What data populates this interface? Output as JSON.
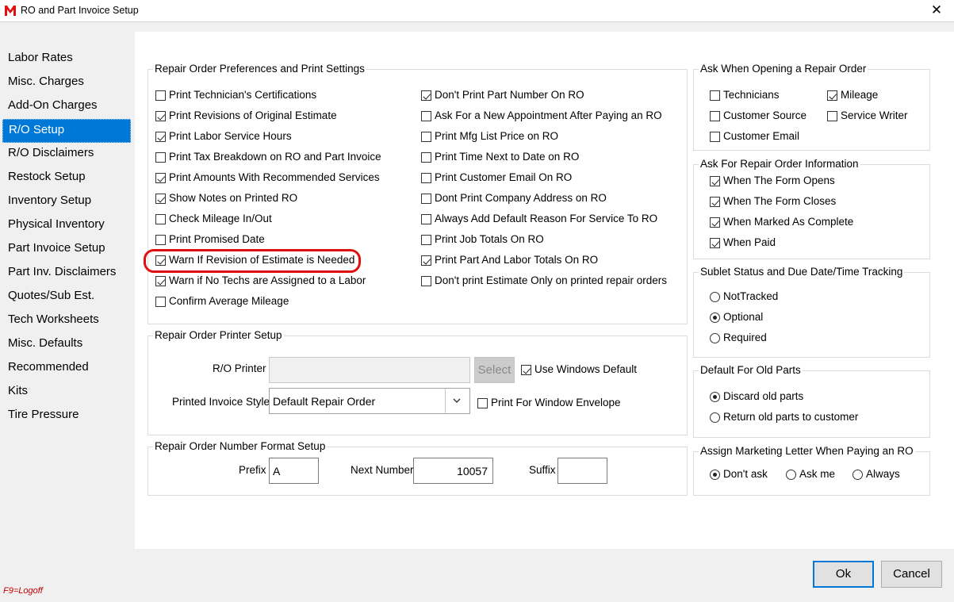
{
  "window": {
    "title": "RO and Part Invoice Setup",
    "close_glyph": "✕",
    "logo_icon": "m-logo-icon",
    "logo_color": "#e01010"
  },
  "sidebar": {
    "items": [
      {
        "label": "Labor Rates",
        "selected": false
      },
      {
        "label": "Misc. Charges",
        "selected": false
      },
      {
        "label": "Add-On Charges",
        "selected": false
      },
      {
        "label": "R/O Setup",
        "selected": true
      },
      {
        "label": "R/O Disclaimers",
        "selected": false
      },
      {
        "label": "Restock Setup",
        "selected": false
      },
      {
        "label": "Inventory Setup",
        "selected": false
      },
      {
        "label": "Physical Inventory",
        "selected": false
      },
      {
        "label": "Part Invoice Setup",
        "selected": false
      },
      {
        "label": "Part Inv. Disclaimers",
        "selected": false
      },
      {
        "label": "Quotes/Sub Est.",
        "selected": false
      },
      {
        "label": "Tech Worksheets",
        "selected": false
      },
      {
        "label": "Misc. Defaults",
        "selected": false
      },
      {
        "label": "Recommended",
        "selected": false
      },
      {
        "label": "Kits",
        "selected": false
      },
      {
        "label": "Tire Pressure",
        "selected": false
      }
    ]
  },
  "prefs": {
    "title": "Repair Order Preferences and Print Settings",
    "left": [
      {
        "label": "Print Technician's Certifications",
        "checked": false
      },
      {
        "label": "Print Revisions of Original Estimate",
        "checked": true
      },
      {
        "label": "Print Labor Service Hours",
        "checked": true
      },
      {
        "label": "Print Tax Breakdown on RO and Part Invoice",
        "checked": false
      },
      {
        "label": "Print Amounts With Recommended Services",
        "checked": true
      },
      {
        "label": "Show Notes on Printed RO",
        "checked": true
      },
      {
        "label": "Check Mileage In/Out",
        "checked": false
      },
      {
        "label": "Print Promised Date",
        "checked": false
      },
      {
        "label": "Warn If Revision of Estimate is Needed",
        "checked": true
      },
      {
        "label": "Warn if No Techs are Assigned to a Labor",
        "checked": true
      },
      {
        "label": "Confirm Average Mileage",
        "checked": false
      }
    ],
    "right": [
      {
        "label": "Don't Print Part Number On RO",
        "checked": true
      },
      {
        "label": "Ask For a New Appointment After Paying an RO",
        "checked": false
      },
      {
        "label": "Print Mfg List Price on RO",
        "checked": false
      },
      {
        "label": "Print Time Next to Date on RO",
        "checked": false
      },
      {
        "label": "Print Customer Email On RO",
        "checked": false
      },
      {
        "label": "Dont Print Company Address on RO",
        "checked": false
      },
      {
        "label": "Always Add Default Reason For Service To RO",
        "checked": false
      },
      {
        "label": "Print Job Totals On RO",
        "checked": false
      },
      {
        "label": "Print Part And Labor Totals On RO",
        "checked": true
      },
      {
        "label": "Don't print Estimate Only on printed repair orders",
        "checked": false
      }
    ]
  },
  "printer": {
    "title": "Repair Order Printer Setup",
    "ro_printer_label": "R/O Printer",
    "ro_printer_value": "",
    "select_label": "Select",
    "use_windows_default": {
      "label": "Use Windows Default",
      "checked": true
    },
    "invoice_style_label": "Printed Invoice Style",
    "invoice_style_value": "Default Repair Order",
    "window_envelope": {
      "label": "Print For Window Envelope",
      "checked": false
    }
  },
  "number_format": {
    "title": "Repair Order Number Format Setup",
    "prefix_label": "Prefix",
    "prefix_value": "A",
    "next_label": "Next Number",
    "next_value": "10057",
    "suffix_label": "Suffix",
    "suffix_value": ""
  },
  "ask_opening": {
    "title": "Ask When Opening a Repair Order",
    "items": [
      {
        "label": "Technicians",
        "checked": false
      },
      {
        "label": "Mileage",
        "checked": true
      },
      {
        "label": "Customer Source",
        "checked": false
      },
      {
        "label": "Service Writer",
        "checked": false
      },
      {
        "label": "Customer Email",
        "checked": false
      }
    ]
  },
  "ask_info": {
    "title": "Ask For Repair Order Information",
    "items": [
      {
        "label": "When The Form Opens",
        "checked": true
      },
      {
        "label": "When The Form Closes",
        "checked": true
      },
      {
        "label": "When Marked As Complete",
        "checked": true
      },
      {
        "label": "When Paid",
        "checked": true
      }
    ]
  },
  "sublet": {
    "title": "Sublet Status and Due Date/Time Tracking",
    "options": [
      {
        "label": "NotTracked",
        "selected": false
      },
      {
        "label": "Optional",
        "selected": true
      },
      {
        "label": "Required",
        "selected": false
      }
    ]
  },
  "old_parts": {
    "title": "Default For Old Parts",
    "options": [
      {
        "label": "Discard old parts",
        "selected": true
      },
      {
        "label": "Return old parts to customer",
        "selected": false
      }
    ]
  },
  "marketing": {
    "title": "Assign Marketing Letter When Paying an RO",
    "options": [
      {
        "label": "Don't ask",
        "selected": true
      },
      {
        "label": "Ask me",
        "selected": false
      },
      {
        "label": "Always",
        "selected": false
      }
    ]
  },
  "footer": {
    "ok_label": "Ok",
    "cancel_label": "Cancel",
    "hotkey_text": "F9=Logoff"
  },
  "highlight_color": "#e01010",
  "accent_color": "#0078d7"
}
